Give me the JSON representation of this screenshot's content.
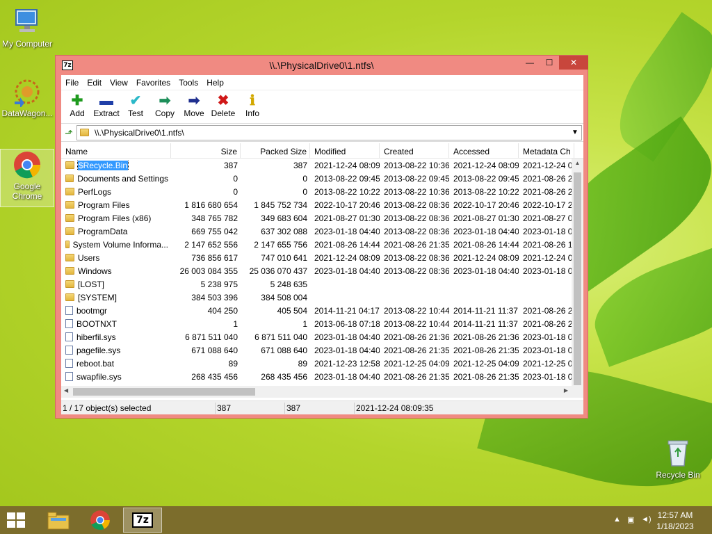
{
  "desktop": {
    "icons": [
      {
        "label": "My Computer"
      },
      {
        "label": "DataWagon..."
      },
      {
        "label": "Google Chrome"
      },
      {
        "label": "Recycle Bin"
      }
    ]
  },
  "window": {
    "title": "\\\\.\\PhysicalDrive0\\1.ntfs\\",
    "app_icon_text": "7z",
    "controls": {
      "minimize": "—",
      "maximize": "☐",
      "close": "✕"
    }
  },
  "menu": [
    "File",
    "Edit",
    "View",
    "Favorites",
    "Tools",
    "Help"
  ],
  "toolbar": [
    {
      "label": "Add",
      "icon": "plus-icon",
      "glyph": "✚",
      "color": "#1e9a1e"
    },
    {
      "label": "Extract",
      "icon": "minus-icon",
      "glyph": "▬",
      "color": "#1f3fa8"
    },
    {
      "label": "Test",
      "icon": "check-icon",
      "glyph": "✔",
      "color": "#2bb8c8"
    },
    {
      "label": "Copy",
      "icon": "copy-arrow-icon",
      "glyph": "➡",
      "color": "#1e8f5a"
    },
    {
      "label": "Move",
      "icon": "move-arrow-icon",
      "glyph": "➡",
      "color": "#1f2f8f"
    },
    {
      "label": "Delete",
      "icon": "x-icon",
      "glyph": "✖",
      "color": "#d01818"
    },
    {
      "label": "Info",
      "icon": "info-icon",
      "glyph": "ℹ",
      "color": "#d2a800"
    }
  ],
  "address": {
    "path": "\\\\.\\PhysicalDrive0\\1.ntfs\\"
  },
  "columns": [
    "Name",
    "Size",
    "Packed Size",
    "Modified",
    "Created",
    "Accessed",
    "Metadata Ch"
  ],
  "rows": [
    {
      "name": "$Recycle.Bin",
      "type": "folder",
      "size": "387",
      "packed": "387",
      "modified": "2021-12-24 08:09",
      "created": "2013-08-22 10:36",
      "accessed": "2021-12-24 08:09",
      "meta": "2021-12-24 0",
      "selected": true
    },
    {
      "name": "Documents and Settings",
      "type": "folder",
      "size": "0",
      "packed": "0",
      "modified": "2013-08-22 09:45",
      "created": "2013-08-22 09:45",
      "accessed": "2013-08-22 09:45",
      "meta": "2021-08-26 2"
    },
    {
      "name": "PerfLogs",
      "type": "folder",
      "size": "0",
      "packed": "0",
      "modified": "2013-08-22 10:22",
      "created": "2013-08-22 10:36",
      "accessed": "2013-08-22 10:22",
      "meta": "2021-08-26 2"
    },
    {
      "name": "Program Files",
      "type": "folder",
      "size": "1 816 680 654",
      "packed": "1 845 752 734",
      "modified": "2022-10-17 20:46",
      "created": "2013-08-22 08:36",
      "accessed": "2022-10-17 20:46",
      "meta": "2022-10-17 2"
    },
    {
      "name": "Program Files (x86)",
      "type": "folder",
      "size": "348 765 782",
      "packed": "349 683 604",
      "modified": "2021-08-27 01:30",
      "created": "2013-08-22 08:36",
      "accessed": "2021-08-27 01:30",
      "meta": "2021-08-27 0"
    },
    {
      "name": "ProgramData",
      "type": "folder",
      "size": "669 755 042",
      "packed": "637 302 088",
      "modified": "2023-01-18 04:40",
      "created": "2013-08-22 08:36",
      "accessed": "2023-01-18 04:40",
      "meta": "2023-01-18 0"
    },
    {
      "name": "System Volume Informa...",
      "type": "folder",
      "size": "2 147 652 556",
      "packed": "2 147 655 756",
      "modified": "2021-08-26 14:44",
      "created": "2021-08-26 21:35",
      "accessed": "2021-08-26 14:44",
      "meta": "2021-08-26 1"
    },
    {
      "name": "Users",
      "type": "folder",
      "size": "736 856 617",
      "packed": "747 010 641",
      "modified": "2021-12-24 08:09",
      "created": "2013-08-22 08:36",
      "accessed": "2021-12-24 08:09",
      "meta": "2021-12-24 0"
    },
    {
      "name": "Windows",
      "type": "folder",
      "size": "26 003 084 355",
      "packed": "25 036 070 437",
      "modified": "2023-01-18 04:40",
      "created": "2013-08-22 08:36",
      "accessed": "2023-01-18 04:40",
      "meta": "2023-01-18 0"
    },
    {
      "name": "[LOST]",
      "type": "folder",
      "size": "5 238 975",
      "packed": "5 248 635",
      "modified": "",
      "created": "",
      "accessed": "",
      "meta": ""
    },
    {
      "name": "[SYSTEM]",
      "type": "folder",
      "size": "384 503 396",
      "packed": "384 508 004",
      "modified": "",
      "created": "",
      "accessed": "",
      "meta": ""
    },
    {
      "name": "bootmgr",
      "type": "file",
      "size": "404 250",
      "packed": "405 504",
      "modified": "2014-11-21 04:17",
      "created": "2013-08-22 10:44",
      "accessed": "2014-11-21 11:37",
      "meta": "2021-08-26 2"
    },
    {
      "name": "BOOTNXT",
      "type": "file",
      "size": "1",
      "packed": "1",
      "modified": "2013-06-18 07:18",
      "created": "2013-08-22 10:44",
      "accessed": "2014-11-21 11:37",
      "meta": "2021-08-26 2"
    },
    {
      "name": "hiberfil.sys",
      "type": "file",
      "size": "6 871 511 040",
      "packed": "6 871 511 040",
      "modified": "2023-01-18 04:40",
      "created": "2021-08-26 21:36",
      "accessed": "2021-08-26 21:36",
      "meta": "2023-01-18 0"
    },
    {
      "name": "pagefile.sys",
      "type": "file",
      "size": "671 088 640",
      "packed": "671 088 640",
      "modified": "2023-01-18 04:40",
      "created": "2021-08-26 21:35",
      "accessed": "2021-08-26 21:35",
      "meta": "2023-01-18 0"
    },
    {
      "name": "reboot.bat",
      "type": "file",
      "size": "89",
      "packed": "89",
      "modified": "2021-12-23 12:58",
      "created": "2021-12-25 04:09",
      "accessed": "2021-12-25 04:09",
      "meta": "2021-12-25 0"
    },
    {
      "name": "swapfile.sys",
      "type": "file",
      "size": "268 435 456",
      "packed": "268 435 456",
      "modified": "2023-01-18 04:40",
      "created": "2021-08-26 21:35",
      "accessed": "2021-08-26 21:35",
      "meta": "2023-01-18 0"
    }
  ],
  "status": {
    "selection": "1 / 17 object(s) selected",
    "size": "387",
    "packed": "387",
    "date": "2021-12-24 08:09:35"
  },
  "taskbar": {
    "time": "12:57 AM",
    "date": "1/18/2023",
    "sevenzip_label": "7z"
  },
  "colors": {
    "title_bar": "#f08a82",
    "selection": "#3399ff",
    "taskbar": "#7c6d2c"
  }
}
